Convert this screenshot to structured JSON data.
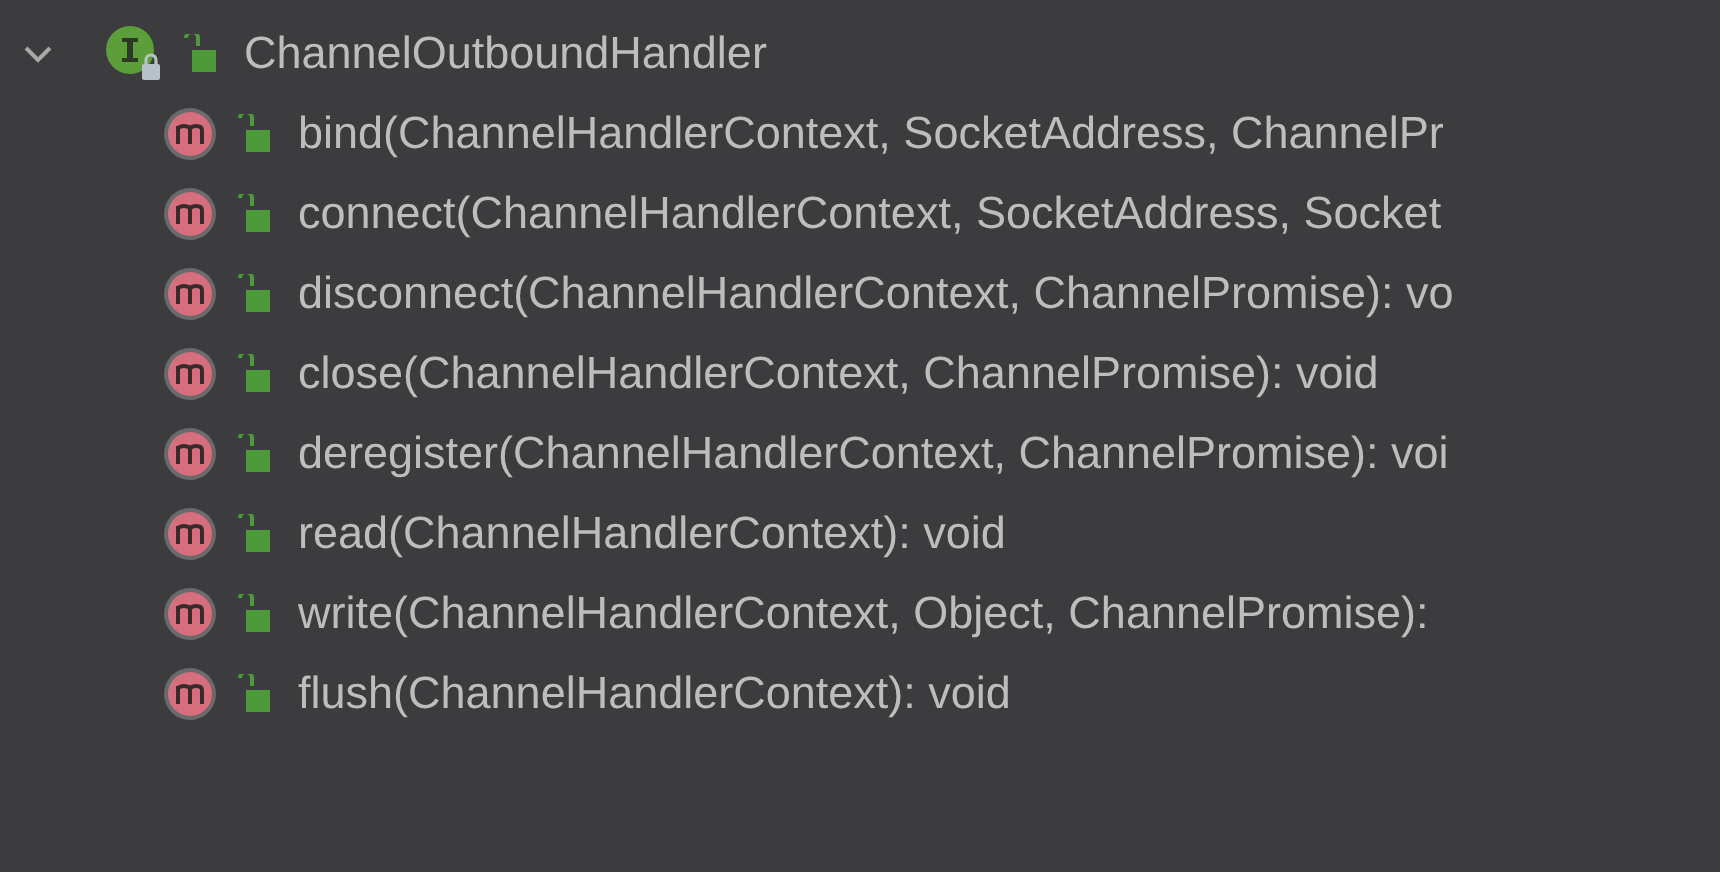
{
  "tree": {
    "label": "ChannelOutboundHandler",
    "expanded": true,
    "kind": "interface",
    "children": [
      {
        "label": "bind(ChannelHandlerContext, SocketAddress, ChannelPr",
        "kind": "method"
      },
      {
        "label": "connect(ChannelHandlerContext, SocketAddress, Socket",
        "kind": "method"
      },
      {
        "label": "disconnect(ChannelHandlerContext, ChannelPromise): vo",
        "kind": "method"
      },
      {
        "label": "close(ChannelHandlerContext, ChannelPromise): void",
        "kind": "method"
      },
      {
        "label": "deregister(ChannelHandlerContext, ChannelPromise): voi",
        "kind": "method"
      },
      {
        "label": "read(ChannelHandlerContext): void",
        "kind": "method"
      },
      {
        "label": "write(ChannelHandlerContext, Object, ChannelPromise):",
        "kind": "method"
      },
      {
        "label": "flush(ChannelHandlerContext): void",
        "kind": "method"
      }
    ]
  }
}
